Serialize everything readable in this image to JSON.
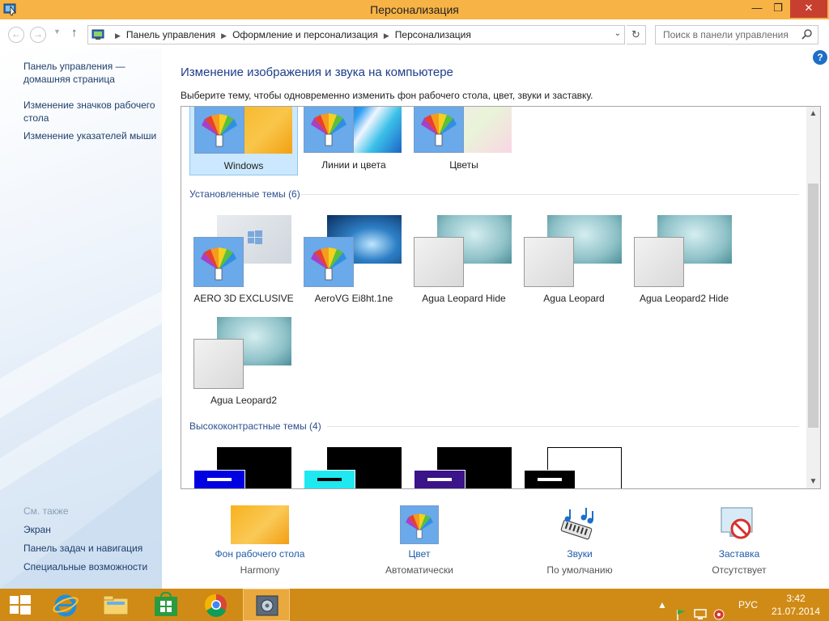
{
  "window": {
    "title": "Персонализация",
    "min_label": "—",
    "max_label": "❐",
    "close_label": "✕"
  },
  "nav": {
    "back": "←",
    "forward": "→",
    "up": "↑",
    "breadcrumbs": [
      "Панель управления",
      "Оформление и персонализация",
      "Персонализация"
    ],
    "search_placeholder": "Поиск в панели управления"
  },
  "sidebar": {
    "links": [
      {
        "label": "Панель управления —",
        "label2": "домашняя страница"
      },
      {
        "label": "Изменение значков рабочего",
        "label2": "стола"
      },
      {
        "label": "Изменение указателей мыши",
        "label2": ""
      }
    ],
    "see_also_label": "См. также",
    "see_also": [
      "Экран",
      "Панель задач и навигация",
      "Специальные возможности"
    ]
  },
  "main": {
    "title": "Изменение изображения и звука на компьютере",
    "description": "Выберите тему, чтобы одновременно изменить фон рабочего стола, цвет, звуки и заставку.",
    "default_themes": [
      "Windows",
      "Линии и цвета",
      "Цветы"
    ],
    "installed_header": "Установленные темы (6)",
    "installed_themes": [
      "AERO 3D EXCLUSIVE",
      "AeroVG Ei8ht.1ne",
      "Agua Leopard Hide",
      "Agua Leopard",
      "Agua Leopard2 Hide",
      "Agua Leopard2"
    ],
    "high_contrast_header": "Высококонтрастные темы (4)",
    "selected_theme": "Windows"
  },
  "options": [
    {
      "link": "Фон рабочего стола",
      "value": "Harmony"
    },
    {
      "link": "Цвет",
      "value": "Автоматически"
    },
    {
      "link": "Звуки",
      "value": "По умолчанию"
    },
    {
      "link": "Заставка",
      "value": "Отсутствует"
    }
  ],
  "taskbar": {
    "language": "РУС",
    "time": "3:42",
    "date": "21.07.2014"
  },
  "colors": {
    "title_bar": "#f7b345",
    "taskbar": "#d08b16",
    "link": "#1f5ba8",
    "heading": "#1e3d8a"
  }
}
